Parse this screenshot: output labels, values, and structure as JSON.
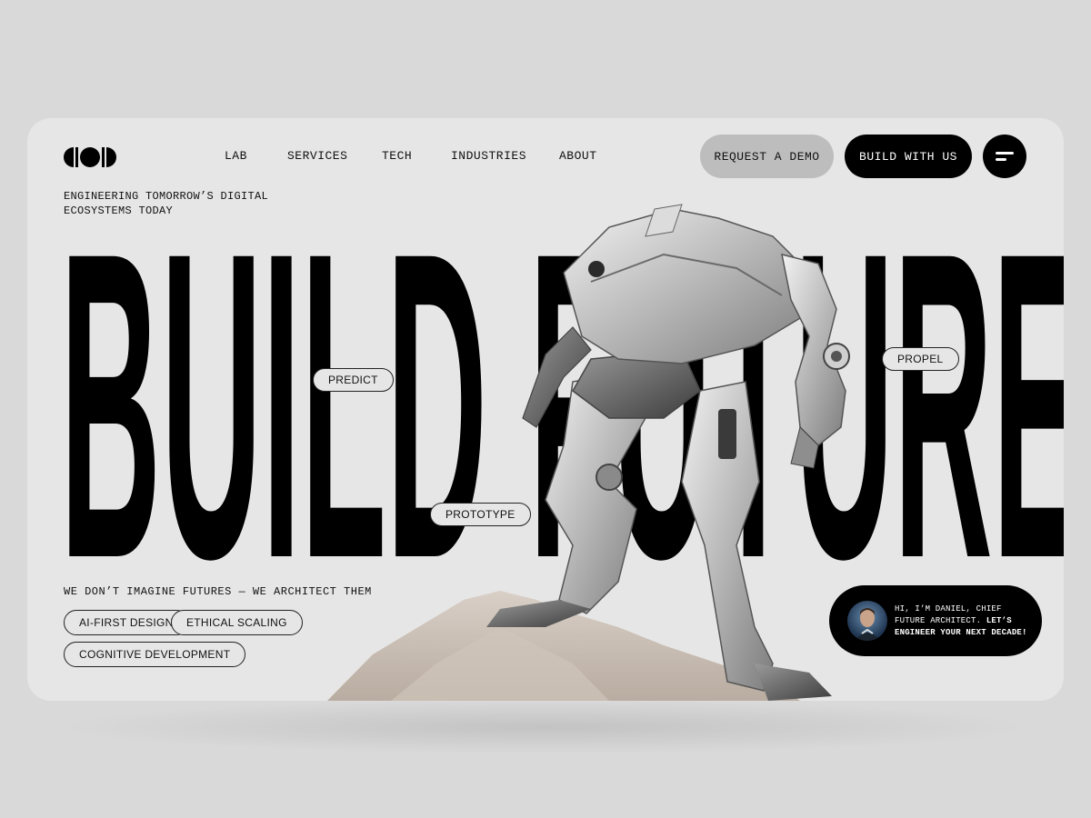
{
  "brand": {
    "logo_icon": "brand-logo-icon"
  },
  "nav": {
    "items": [
      "LAB",
      "SERVICES",
      "TECH",
      "INDUSTRIES",
      "ABOUT"
    ]
  },
  "header": {
    "request_demo_label": "REQUEST A DEMO",
    "build_label": "BUILD WITH US",
    "menu_icon": "menu-icon"
  },
  "hero": {
    "tagline": "ENGINEERING TOMORROW’S DIGITAL ECOSYSTEMS TODAY",
    "headline_word_1": "BUILD",
    "headline_word_2": "FUTURE",
    "floating_tags": [
      "PREDICT",
      "PROTOTYPE",
      "PROPEL"
    ],
    "manifesto": "WE DON’T IMAGINE FUTURES — WE ARCHITECT THEM",
    "capability_tags": [
      "AI-FIRST DESIGN",
      "ETHICAL SCALING",
      "COGNITIVE DEVELOPMENT"
    ]
  },
  "chat_card": {
    "intro": "HI, I’M DANIEL, CHIEF FUTURE ARCHITECT.",
    "highlight": "LET’S ENGINEER YOUR NEXT DECADE!"
  },
  "colors": {
    "page_bg": "#d9d9d9",
    "card_bg": "#e6e6e6",
    "ink": "#000000",
    "demo_button_bg": "#bdbdbd"
  }
}
